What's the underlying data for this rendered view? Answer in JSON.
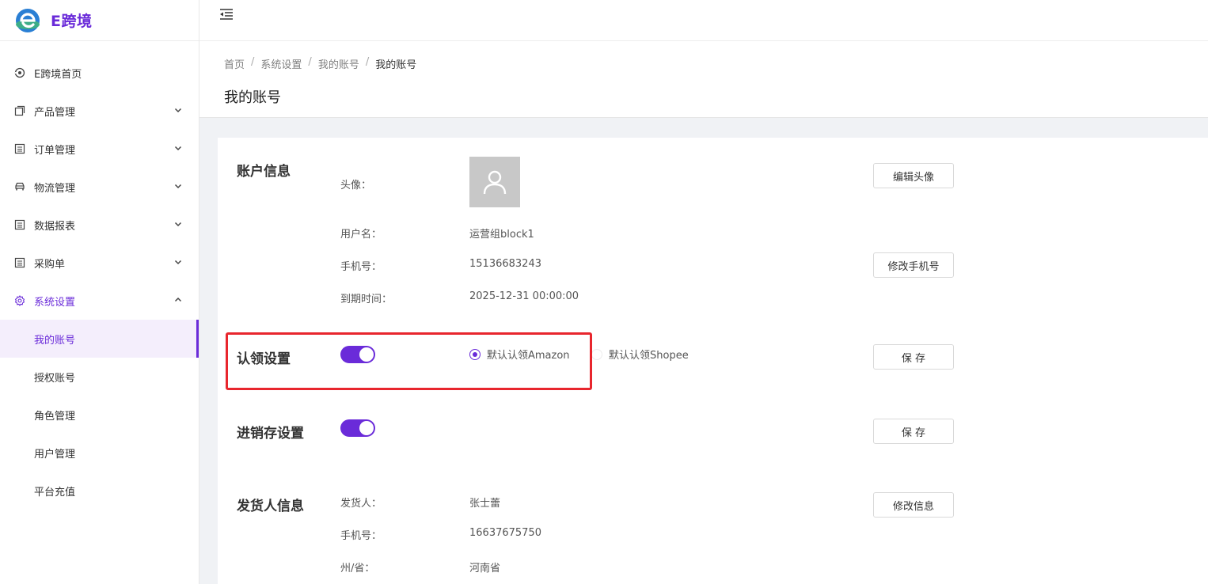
{
  "app": {
    "logo_text": "E跨境",
    "brand_color": "#6a2bd9"
  },
  "sidebar": {
    "items": [
      {
        "label": "E跨境首页",
        "icon": "eye-icon"
      },
      {
        "label": "产品管理",
        "icon": "copy-icon"
      },
      {
        "label": "订单管理",
        "icon": "list-icon"
      },
      {
        "label": "物流管理",
        "icon": "car-icon"
      },
      {
        "label": "数据报表",
        "icon": "list-icon"
      },
      {
        "label": "采购单",
        "icon": "list-icon"
      },
      {
        "label": "系统设置",
        "icon": "gear-icon"
      }
    ],
    "submenu": [
      {
        "label": "我的账号"
      },
      {
        "label": "授权账号"
      },
      {
        "label": "角色管理"
      },
      {
        "label": "用户管理"
      },
      {
        "label": "平台充值"
      }
    ]
  },
  "breadcrumb": {
    "home": "首页",
    "settings": "系统设置",
    "account": "我的账号",
    "current": "我的账号"
  },
  "page": {
    "title": "我的账号"
  },
  "account_info": {
    "title": "账户信息",
    "avatar_label": "头像：",
    "edit_avatar_button": "编辑头像",
    "username_label": "用户名：",
    "username": "运营组block1",
    "phone_label": "手机号：",
    "phone": "15136683243",
    "edit_phone_button": "修改手机号",
    "expiry_label": "到期时间：",
    "expiry": "2025-12-31 00:00:00"
  },
  "claim_settings": {
    "title": "认领设置",
    "enabled": true,
    "option_amazon": "默认认领Amazon",
    "option_shopee": "默认认领Shopee",
    "selected": "amazon",
    "save_button": "保 存"
  },
  "inventory_settings": {
    "title": "进销存设置",
    "enabled": true,
    "save_button": "保 存"
  },
  "shipper_info": {
    "title": "发货人信息",
    "edit_button": "修改信息",
    "shipper_label": "发货人：",
    "shipper": "张士蕾",
    "phone_label": "手机号：",
    "phone": "16637675750",
    "province_label": "州/省：",
    "province": "河南省"
  }
}
